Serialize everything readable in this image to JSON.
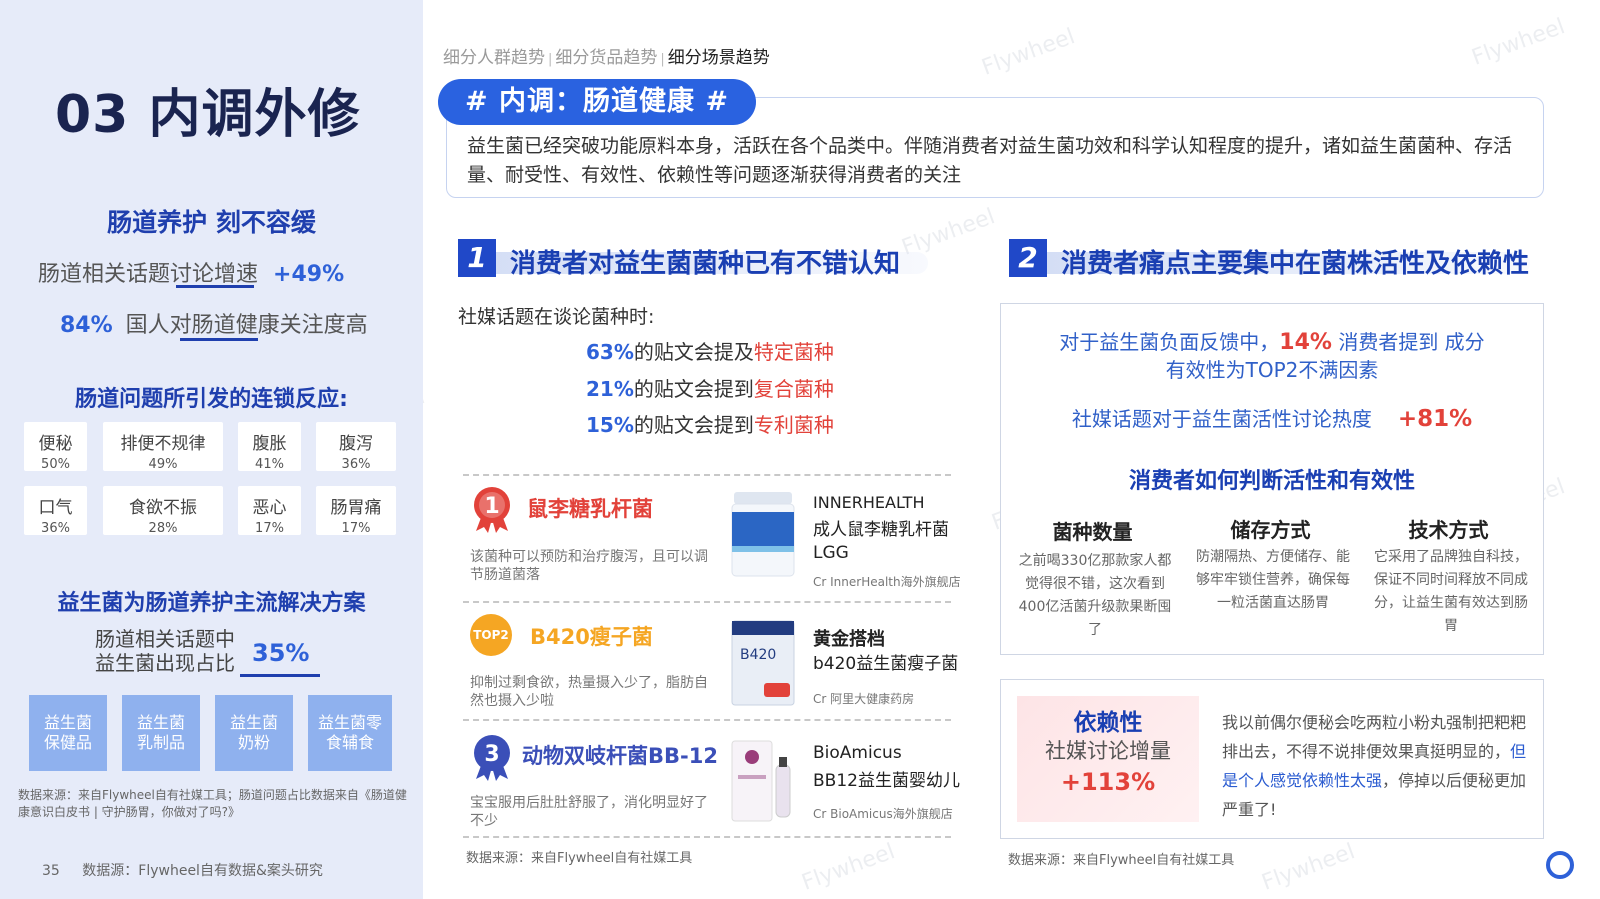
{
  "left": {
    "title": "03 内调外修",
    "heading1": "肠道养护 刻不容缓",
    "stat1_text": "肠道相关话题讨论增速",
    "stat1_value": "+49%",
    "stat2_value": "84%",
    "stat2_text": "国人对肠道健康关注度高",
    "heading2": "肠道问题所引发的连锁反应:",
    "symptoms": [
      {
        "name": "便秘",
        "pct": "50%"
      },
      {
        "name": "排便不规律",
        "pct": "49%"
      },
      {
        "name": "腹胀",
        "pct": "41%"
      },
      {
        "name": "腹泻",
        "pct": "36%"
      },
      {
        "name": "口气",
        "pct": "36%"
      },
      {
        "name": "食欲不振",
        "pct": "28%"
      },
      {
        "name": "恶心",
        "pct": "17%"
      },
      {
        "name": "肠胃痛",
        "pct": "17%"
      }
    ],
    "heading3": "益生菌为肠道养护主流解决方案",
    "share_line1": "肠道相关话题中",
    "share_line2": "益生菌出现占比",
    "share_value": "35%",
    "solutions": [
      "益生菌\n保健品",
      "益生菌\n乳制品",
      "益生菌\n奶粉",
      "益生菌零\n食辅食"
    ],
    "source_note": "数据来源：来自Flywheel自有社媒工具；肠道问题占比数据来自《肠道健康意识白皮书 | 守护肠胃，你做对了吗?》",
    "page_number": "35",
    "footer_source": "数据源：Flywheel自有数据&案头研究"
  },
  "breadcrumb": {
    "item1": "细分人群趋势",
    "item2": "细分货品趋势",
    "item3": "细分场景趋势",
    "sep": "|"
  },
  "tag": "# 内调：肠道健康 #",
  "intro": "益生菌已经突破功能原料本身，活跃在各个品类中。伴随消费者对益生菌功效和科学认知程度的提升，诸如益生菌菌种、存活量、耐受性、有效性、依赖性等问题逐渐获得消费者的关注",
  "section1": {
    "num": "1",
    "title": "消费者对益生菌菌种已有不错认知",
    "lead": "社媒话题在谈论菌种时:",
    "lines": [
      {
        "pct": "63%",
        "text": "的贴文会提及",
        "red": "特定菌种"
      },
      {
        "pct": "21%",
        "text": "的贴文会提到",
        "red": "复合菌种"
      },
      {
        "pct": "15%",
        "text": "的贴文会提到",
        "red": "专利菌种"
      }
    ],
    "strains": [
      {
        "rank": "1",
        "name": "鼠李糖乳杆菌",
        "desc": "该菌种可以预防和治疗腹泻，且可以调节肠道菌落",
        "brand": "INNERHEALTH",
        "product": "成人鼠李糖乳杆菌LGG",
        "cr": "Cr InnerHealth海外旗舰店",
        "color": "#e2423a"
      },
      {
        "rank": "TOP2",
        "name": "B420瘦子菌",
        "desc": "抑制过剩食欲，热量摄入少了，脂肪自然也摄入少啦",
        "brand": "黄金搭档",
        "product": "b420益生菌瘦子菌",
        "cr": "Cr 阿里大健康药房",
        "color": "#f5a623"
      },
      {
        "rank": "3",
        "name": "动物双岐杆菌BB-12",
        "desc": "宝宝服用后肚肚舒服了，消化明显好了不少",
        "brand": "BioAmicus",
        "product": "BB12益生菌婴幼儿",
        "cr": "Cr BioAmicus海外旗舰店",
        "color": "#3b4fb8"
      }
    ],
    "source": "数据来源：来自Flywheel自有社媒工具"
  },
  "section2": {
    "num": "2",
    "title": "消费者痛点主要集中在菌株活性及依赖性",
    "line1a": "对于益生菌负面反馈中，",
    "line1_pct": "14%",
    "line1b": " 消费者提到 成分",
    "line2": "有效性为TOP2不满因素",
    "line3": "社媒话题对于益生菌活性讨论热度",
    "line3_pct": "+81%",
    "sub_heading": "消费者如何判断活性和有效性",
    "columns": [
      {
        "title": "菌种数量",
        "desc": "之前喝330亿那款家人都觉得很不错，这次看到400亿活菌升级款果断囤了"
      },
      {
        "title": "储存方式",
        "desc": "防潮隔热、方便储存、能够牢牢锁住营养，确保每一粒活菌直达肠胃"
      },
      {
        "title": "技术方式",
        "desc": "它采用了品牌独自科技，保证不同时间释放不同成分，让益生菌有效达到肠胃"
      }
    ],
    "dep_title": "依赖性",
    "dep_sub": "社媒讨论增量",
    "dep_value": "+113%",
    "quote_a": "我以前偶尔便秘会吃两粒小粉丸强制把粑粑排出去，不得不说排便效果真挺明显的，",
    "quote_hl": "但是个人感觉依赖性太强",
    "quote_b": "，停掉以后便秘更加严重了!",
    "source": "数据来源：来自Flywheel自有社媒工具"
  },
  "watermark": "Flywheel",
  "colors": {
    "brand_blue": "#2a62e0",
    "dark_navy": "#1a2450",
    "accent_red": "#e2423a",
    "left_bg": "#e6ebf9"
  }
}
